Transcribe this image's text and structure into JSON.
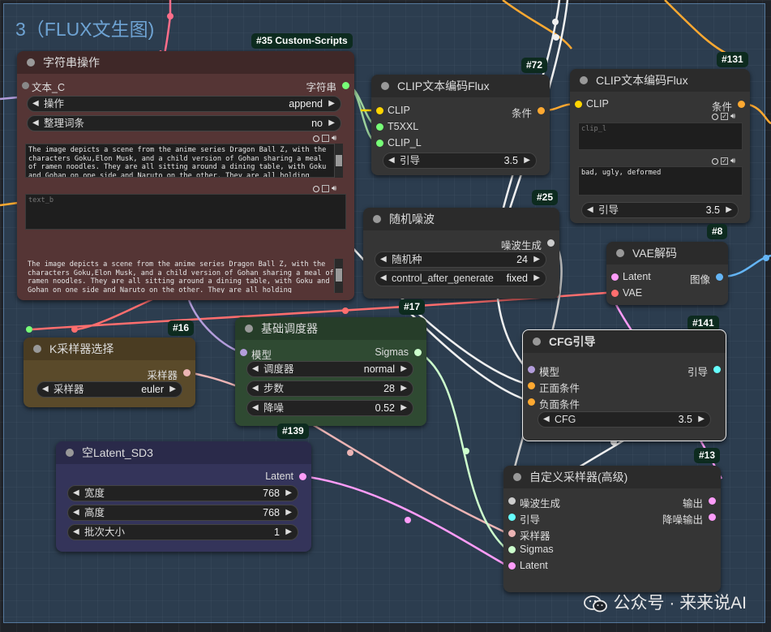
{
  "group": {
    "title": "3（FLUX文生图)"
  },
  "watermark": "公众号 · 来来说AI",
  "nodes": {
    "string_op": {
      "badge": "#35 Custom-Scripts",
      "title": "字符串操作",
      "input_label": "文本_C",
      "output_label": "字符串",
      "op_label": "操作",
      "op_value": "append",
      "tidy_label": "整理词条",
      "tidy_value": "no",
      "text_a": "The image depicts a scene from the anime series Dragon Ball Z, with the characters Goku,Elon Musk, and a child version of Gohan sharing a meal of ramen noodles. They are all sitting around a dining table, with Goku and Gohan on one side and Naruto on the other. They are all holding chopsticks",
      "text_b_placeholder": "text_b",
      "text_out": "The image depicts a scene from the anime series Dragon Ball Z, with the characters Goku,Elon Musk, and a child version of Gohan sharing a meal of ramen noodles. They are all sitting around a dining table, with Goku and Gohan on one side and Naruto on the other. They are all holding chopsticks"
    },
    "clip72": {
      "badge": "#72",
      "title": "CLIP文本编码Flux",
      "in_clip": "CLIP",
      "in_t5": "T5XXL",
      "in_clipl": "CLIP_L",
      "out": "条件",
      "guide_label": "引导",
      "guide_value": "3.5"
    },
    "clip131": {
      "badge": "#131",
      "title": "CLIP文本编码Flux",
      "in_clip": "CLIP",
      "out": "条件",
      "clip_l_placeholder": "clip_l",
      "t5_text": "bad, ugly, deformed",
      "guide_label": "引导",
      "guide_value": "3.5"
    },
    "noise25": {
      "badge": "#25",
      "title": "随机噪波",
      "out": "噪波生成",
      "seed_label": "随机种",
      "seed_value": "24",
      "cag_label": "control_after_generate",
      "cag_value": "fixed"
    },
    "vae8": {
      "badge": "#8",
      "title": "VAE解码",
      "in_latent": "Latent",
      "in_vae": "VAE",
      "out": "图像"
    },
    "ksel16": {
      "badge": "#16",
      "title": "K采样器选择",
      "out": "采样器",
      "sampler_label": "采样器",
      "sampler_value": "euler"
    },
    "sched17": {
      "badge": "#17",
      "title": "基础调度器",
      "in_model": "模型",
      "out": "Sigmas",
      "sched_label": "调度器",
      "sched_value": "normal",
      "steps_label": "步数",
      "steps_value": "28",
      "denoise_label": "降噪",
      "denoise_value": "0.52"
    },
    "cfg141": {
      "badge": "#141",
      "title": "CFG引导",
      "in_model": "模型",
      "in_pos": "正面条件",
      "in_neg": "负面条件",
      "out": "引导",
      "cfg_label": "CFG",
      "cfg_value": "3.5"
    },
    "latent139": {
      "badge": "#139",
      "title": "空Latent_SD3",
      "out": "Latent",
      "w_label": "宽度",
      "w_value": "768",
      "h_label": "高度",
      "h_value": "768",
      "b_label": "批次大小",
      "b_value": "1"
    },
    "sampler13": {
      "badge": "#13",
      "title": "自定义采样器(高级)",
      "in_noise": "噪波生成",
      "in_guide": "引导",
      "in_sampler": "采样器",
      "in_sigmas": "Sigmas",
      "in_latent": "Latent",
      "out1": "输出",
      "out2": "降噪输出"
    }
  },
  "colors": {
    "conditioning": "#ffa931",
    "clip": "#ffd500",
    "model": "#b39ddb",
    "latent": "#ff9cf9",
    "vae": "#ff6e6e",
    "image": "#64b5f6",
    "sigmas": "#cdffcd",
    "sampler": "#ecb4b4",
    "guider": "#66ffff",
    "noise": "#cccccc",
    "string": "#77ff77"
  }
}
